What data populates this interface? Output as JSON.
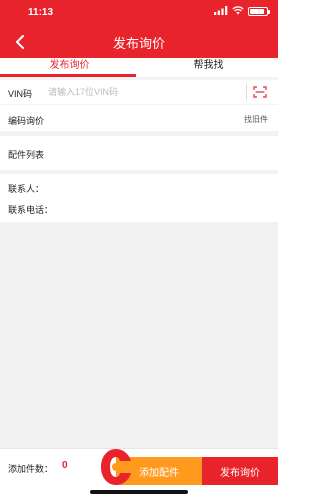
{
  "status_bar": {
    "time": "11:13",
    "battery_level": 0.85
  },
  "nav": {
    "title": "发布询价"
  },
  "tabs": [
    {
      "label": "发布询价",
      "active": true
    },
    {
      "label": "帮我找",
      "active": false
    }
  ],
  "vin": {
    "label": "VIN码",
    "placeholder": "请输入17位VIN码"
  },
  "code_inquiry": {
    "label": "编码询价",
    "action": "找旧件"
  },
  "parts": {
    "label": "配件列表"
  },
  "contact": {
    "name_label": "联系人：",
    "phone_label": "联系电话："
  },
  "bottom": {
    "count_label": "添加件数：",
    "count_value": "0",
    "add_button": "添加配件",
    "publish_button": "发布询价"
  },
  "colors": {
    "brand": "#e8232b",
    "accent": "#ff9a1e",
    "background": "#f2f2f2"
  },
  "icons": [
    "back-arrow-icon",
    "wifi-icon",
    "signal-icon",
    "battery-icon",
    "scan-icon",
    "logo-icon"
  ]
}
